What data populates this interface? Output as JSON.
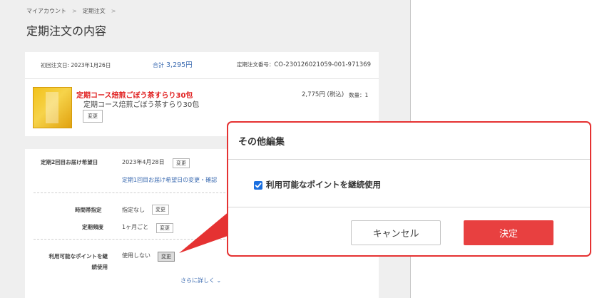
{
  "breadcrumb": {
    "items": [
      "マイアカウント",
      "定期注文"
    ],
    "separator": ">"
  },
  "page_title": "定期注文の内容",
  "summary": {
    "first_order_date": "初回注文日: 2023年1月26日",
    "total_label": "合計",
    "total_amount": "3,295円",
    "total_chevron": "⌄",
    "order_number_label": "定期注文番号：",
    "order_number": "CO-230126021059-001-971369"
  },
  "product": {
    "name_red": "定期コース焙煎ごぼう茶すらり30包",
    "name": "定期コース焙煎ごぼう茶すらり30包",
    "price": "2,775円 (税込)",
    "quantity": "数量：1",
    "change_label": "変更"
  },
  "schedule": {
    "second_delivery_label": "定期2回目お届け希望日",
    "second_delivery_value": "2023年4月28日",
    "second_delivery_change": "変更",
    "first_delivery_link": "定期1回目お届け希望日の変更・確認",
    "time_slot_label": "時間帯指定",
    "time_slot_value": "指定なし",
    "time_slot_change": "変更",
    "frequency_label": "定期頻度",
    "frequency_value": "1ヶ月ごと",
    "frequency_change": "変更",
    "points_label_line1": "利用可能なポイントを継",
    "points_label_line2": "続使用",
    "points_value": "使用しない",
    "points_change": "変更",
    "more_link": "さらに詳しく ⌄"
  },
  "modal": {
    "title": "その他編集",
    "checkbox_label": "利用可能なポイントを継続使用",
    "checkbox_checked": true,
    "cancel_label": "キャンセル",
    "confirm_label": "決定"
  },
  "colors": {
    "accent": "#e84040",
    "link": "#3a6ab0",
    "checkbox": "#1a6fe0",
    "callout": "#e53232"
  }
}
